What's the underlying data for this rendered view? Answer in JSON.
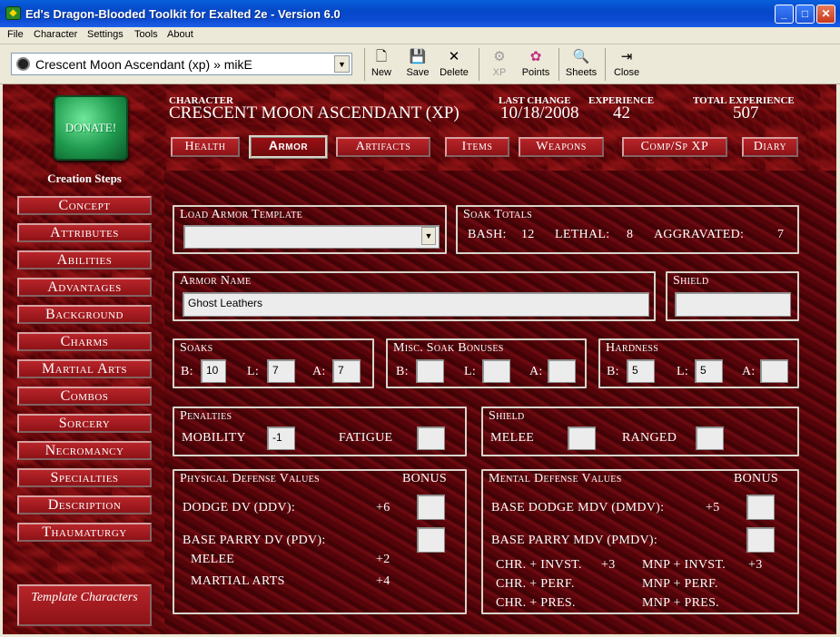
{
  "window": {
    "title": "Ed's Dragon-Blooded Toolkit for Exalted 2e - Version 6.0",
    "minimize": "_",
    "maximize": "□",
    "close": "✕",
    "icon": "dragon-icon"
  },
  "menu": [
    "File",
    "Character",
    "Settings",
    "Tools",
    "About"
  ],
  "toolbar": {
    "character_select": "Crescent Moon Ascendant (xp) » mikE",
    "buttons": [
      {
        "label": "New",
        "icon": "new-document-icon",
        "glyph": "🗋",
        "enabled": true
      },
      {
        "label": "Save",
        "icon": "save-icon",
        "glyph": "💾",
        "enabled": true
      },
      {
        "label": "Delete",
        "icon": "delete-icon",
        "glyph": "✕",
        "enabled": true
      },
      {
        "label": "XP",
        "icon": "xp-icon",
        "glyph": "⚙",
        "enabled": false
      },
      {
        "label": "Points",
        "icon": "points-icon",
        "glyph": "✿",
        "enabled": true
      },
      {
        "label": "Sheets",
        "icon": "sheets-icon",
        "glyph": "🔍",
        "enabled": true
      },
      {
        "label": "Close",
        "icon": "close-door-icon",
        "glyph": "⇥",
        "enabled": true
      }
    ]
  },
  "sidebar": {
    "donate_label": "DONATE!",
    "heading": "Creation Steps",
    "steps": [
      "Concept",
      "Attributes",
      "Abilities",
      "Advantages",
      "Background",
      "Charms",
      "Martial Arts",
      "Combos",
      "Sorcery",
      "Necromancy",
      "Specialties",
      "Description",
      "Thaumaturgy"
    ],
    "template_button": "Template Characters"
  },
  "header": {
    "character_label": "CHARACTER",
    "character_value": "CRESCENT MOON ASCENDANT (XP)",
    "last_change_label": "LAST CHANGE",
    "last_change_value": "10/18/2008",
    "experience_label": "EXPERIENCE",
    "experience_value": "42",
    "total_experience_label": "TOTAL EXPERIENCE",
    "total_experience_value": "507"
  },
  "tabs": [
    {
      "label": "Health",
      "active": false
    },
    {
      "label": "Armor",
      "active": true
    },
    {
      "label": "Artifacts",
      "active": false
    },
    {
      "label": "Items",
      "active": false
    },
    {
      "label": "Weapons",
      "active": false
    },
    {
      "label": "Comp/Sp XP",
      "active": false
    },
    {
      "label": "Diary",
      "active": false
    }
  ],
  "armor": {
    "load_template_title": "Load Armor Template",
    "load_template_value": "",
    "soak_totals": {
      "title": "Soak Totals",
      "bash_label": "BASH:",
      "bash": "12",
      "lethal_label": "LETHAL:",
      "lethal": "8",
      "aggravated_label": "AGGRAVATED:",
      "aggravated": "7"
    },
    "armor_name_title": "Armor Name",
    "armor_name": "Ghost Leathers",
    "shield_title": "Shield",
    "shield_value": "",
    "soaks": {
      "title": "Soaks",
      "b_label": "B:",
      "b": "10",
      "l_label": "L:",
      "l": "7",
      "a_label": "A:",
      "a": "7"
    },
    "misc_soak": {
      "title": "Misc. Soak Bonuses",
      "b_label": "B:",
      "b": "",
      "l_label": "L:",
      "l": "",
      "a_label": "A:",
      "a": ""
    },
    "hardness": {
      "title": "Hardness",
      "b_label": "B:",
      "b": "5",
      "l_label": "L:",
      "l": "5",
      "a_label": "A:",
      "a": ""
    },
    "penalties": {
      "title": "Penalties",
      "mobility_label": "MOBILITY",
      "mobility": "-1",
      "fatigue_label": "FATIGUE",
      "fatigue": ""
    },
    "shield_box": {
      "title": "Shield",
      "melee_label": "MELEE",
      "melee": "",
      "ranged_label": "RANGED",
      "ranged": ""
    },
    "physical_dv": {
      "title": "Physical Defense Values",
      "bonus_label": "BONUS",
      "dodge_label": "DODGE DV (DDV):",
      "dodge_value": "+6",
      "dodge_bonus": "",
      "parry_label": "BASE PARRY DV (PDV):",
      "parry_bonus": "",
      "melee_label": "MELEE",
      "melee_value": "+2",
      "martial_label": "MARTIAL ARTS",
      "martial_value": "+4"
    },
    "mental_dv": {
      "title": "Mental Defense Values",
      "bonus_label": "BONUS",
      "dodge_label": "BASE DODGE MDV (DMDV):",
      "dodge_value": "+5",
      "dodge_bonus": "",
      "parry_label": "BASE PARRY MDV (PMDV):",
      "parry_bonus": "",
      "chr_invst_label": "CHR. + INVST.",
      "chr_invst": "+3",
      "mnp_invst_label": "MNP + INVST.",
      "mnp_invst": "+3",
      "chr_perf_label": "CHR. + PERF.",
      "mnp_perf_label": "MNP + PERF.",
      "chr_pres_label": "CHR. + PRES.",
      "mnp_pres_label": "MNP + PRES."
    }
  }
}
